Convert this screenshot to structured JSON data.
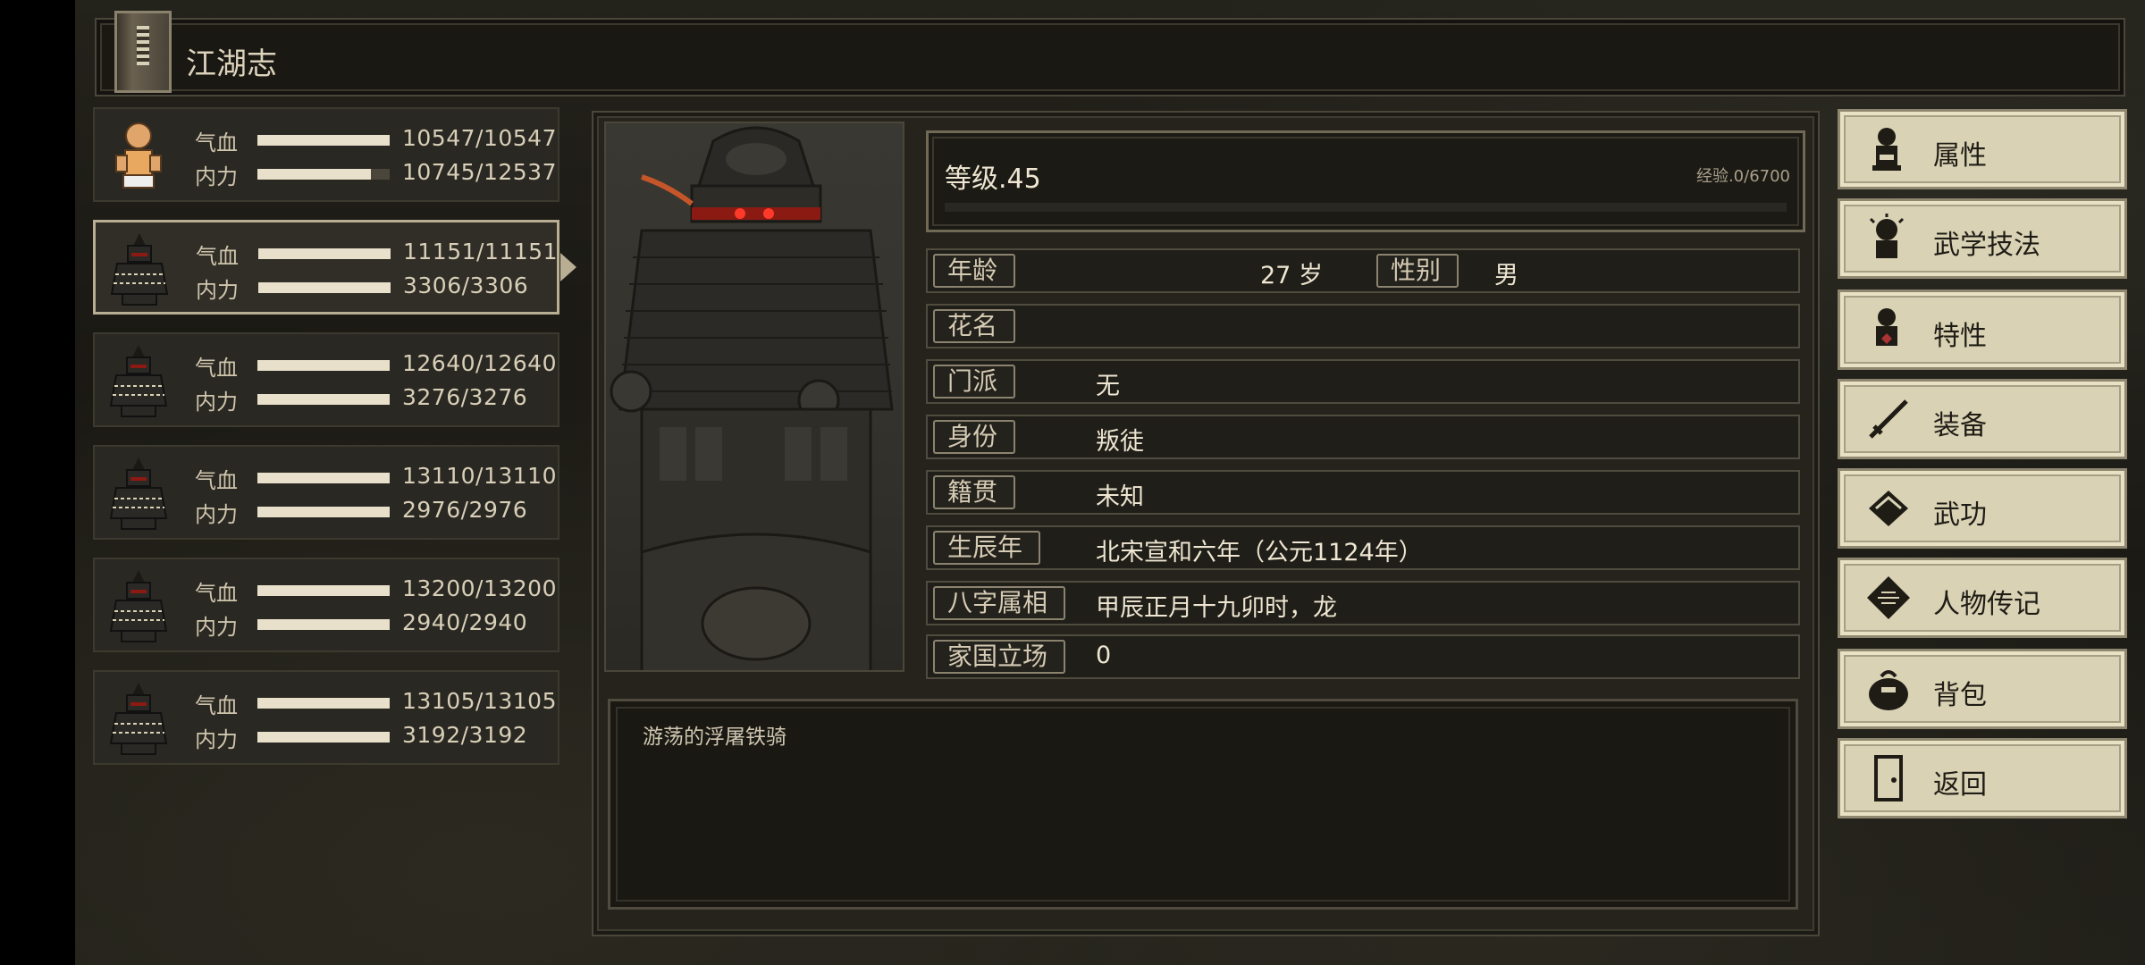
{
  "header": {
    "title": "江湖志"
  },
  "party": [
    {
      "hp_label": "气血",
      "hp": "10547/10547",
      "hp_pct": 100,
      "mp_label": "内力",
      "mp": "10745/12537",
      "mp_pct": 86,
      "portrait": "monk-portrait-icon",
      "active": false
    },
    {
      "hp_label": "气血",
      "hp": "11151/11151",
      "hp_pct": 100,
      "mp_label": "内力",
      "mp": "3306/3306",
      "mp_pct": 100,
      "portrait": "armored-soldier-icon",
      "active": true
    },
    {
      "hp_label": "气血",
      "hp": "12640/12640",
      "hp_pct": 100,
      "mp_label": "内力",
      "mp": "3276/3276",
      "mp_pct": 100,
      "portrait": "armored-soldier-icon",
      "active": false
    },
    {
      "hp_label": "气血",
      "hp": "13110/13110",
      "hp_pct": 100,
      "mp_label": "内力",
      "mp": "2976/2976",
      "mp_pct": 100,
      "portrait": "armored-soldier-icon",
      "active": false
    },
    {
      "hp_label": "气血",
      "hp": "13200/13200",
      "hp_pct": 100,
      "mp_label": "内力",
      "mp": "2940/2940",
      "mp_pct": 100,
      "portrait": "armored-soldier-icon",
      "active": false
    },
    {
      "hp_label": "气血",
      "hp": "13105/13105",
      "hp_pct": 100,
      "mp_label": "内力",
      "mp": "3192/3192",
      "mp_pct": 100,
      "portrait": "armored-soldier-icon",
      "active": false
    }
  ],
  "character": {
    "level_text": "等级.45",
    "exp_text": "经验.0/6700",
    "exp_pct": 0,
    "age_label": "年龄",
    "age_value": "27 岁",
    "gender_label": "性别",
    "gender_value": "男",
    "nickname_label": "花名",
    "nickname_value": "",
    "sect_label": "门派",
    "sect_value": "无",
    "identity_label": "身份",
    "identity_value": "叛徒",
    "origin_label": "籍贯",
    "origin_value": "未知",
    "birth_label": "生辰年",
    "birth_value": "北宋宣和六年（公元1124年）",
    "bazi_label": "八字属相",
    "bazi_value": "甲辰正月十九卯时，龙",
    "stance_label": "家国立场",
    "stance_value": "0",
    "description": "游荡的浮屠铁骑"
  },
  "menu": [
    {
      "label": "属性",
      "icon": "attributes-icon"
    },
    {
      "label": "武学技法",
      "icon": "martial-skills-icon"
    },
    {
      "label": "特性",
      "icon": "traits-icon"
    },
    {
      "label": "装备",
      "icon": "equipment-icon"
    },
    {
      "label": "武功",
      "icon": "kungfu-book-icon"
    },
    {
      "label": "人物传记",
      "icon": "biography-icon"
    },
    {
      "label": "背包",
      "icon": "backpack-icon"
    },
    {
      "label": "返回",
      "icon": "return-door-icon"
    }
  ],
  "colors": {
    "accent": "#d9d2b4",
    "bar_fill": "#e8e0ca",
    "panel": "#25231c"
  }
}
